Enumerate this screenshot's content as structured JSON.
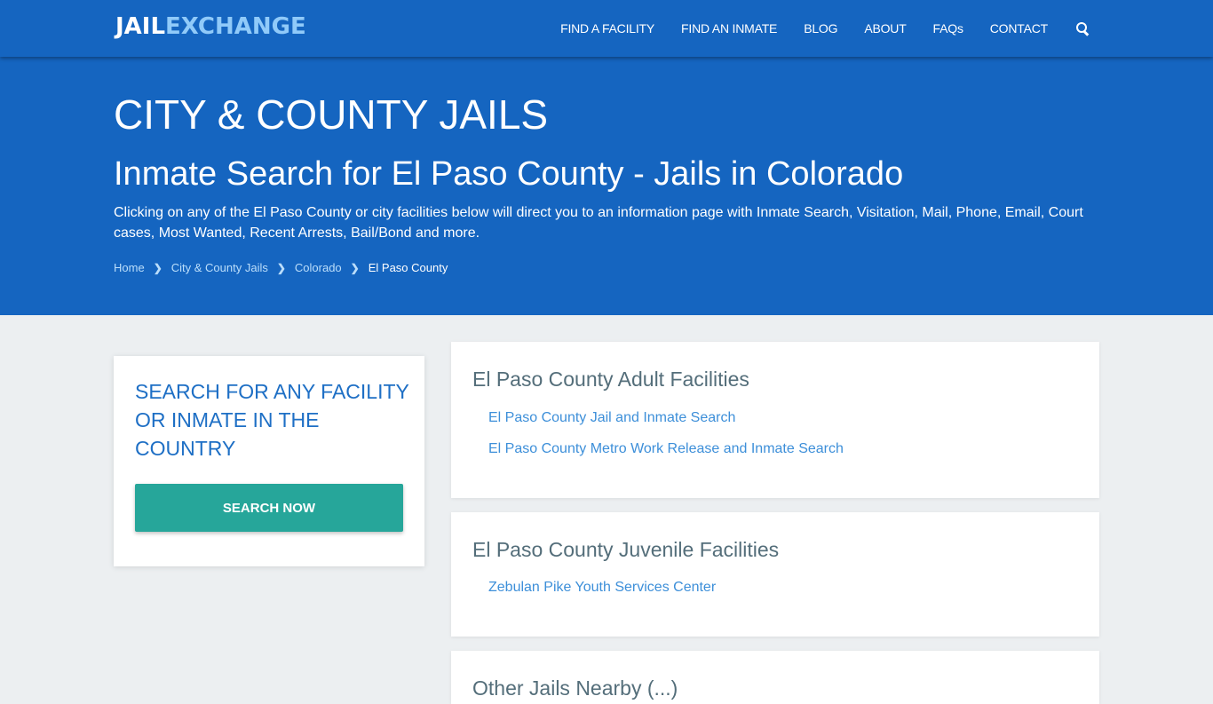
{
  "brand": {
    "part1": "JAIL",
    "part2": "EXCHANGE"
  },
  "nav": {
    "items": [
      "FIND A FACILITY",
      "FIND AN INMATE",
      "BLOG",
      "ABOUT",
      "FAQs",
      "CONTACT"
    ],
    "search_icon": "search-icon"
  },
  "hero": {
    "title": "CITY & COUNTY JAILS",
    "subtitle": "Inmate Search for El Paso County - Jails in Colorado",
    "description": "Clicking on any of the El Paso County or city facilities below will direct you to an information page with Inmate Search, Visitation, Mail, Phone, Email, Court cases, Most Wanted, Recent Arrests, Bail/Bond and more.",
    "breadcrumb": [
      "Home",
      "City & County Jails",
      "Colorado",
      "El Paso County"
    ]
  },
  "sidebar": {
    "heading": "SEARCH FOR ANY FACILITY OR INMATE IN THE COUNTRY",
    "button": "SEARCH NOW"
  },
  "sections": [
    {
      "title": "El Paso County Adult Facilities",
      "links": [
        "El Paso County Jail and Inmate Search",
        "El Paso County Metro Work Release and Inmate Search"
      ]
    },
    {
      "title": "El Paso County Juvenile Facilities",
      "links": [
        "Zebulan Pike Youth Services Center"
      ]
    },
    {
      "title": "Other Jails Nearby (...)",
      "links": []
    }
  ],
  "colors": {
    "primary": "#1565c0",
    "accent": "#26a69a",
    "link": "#3d8fd9",
    "heading": "#546e7a"
  }
}
